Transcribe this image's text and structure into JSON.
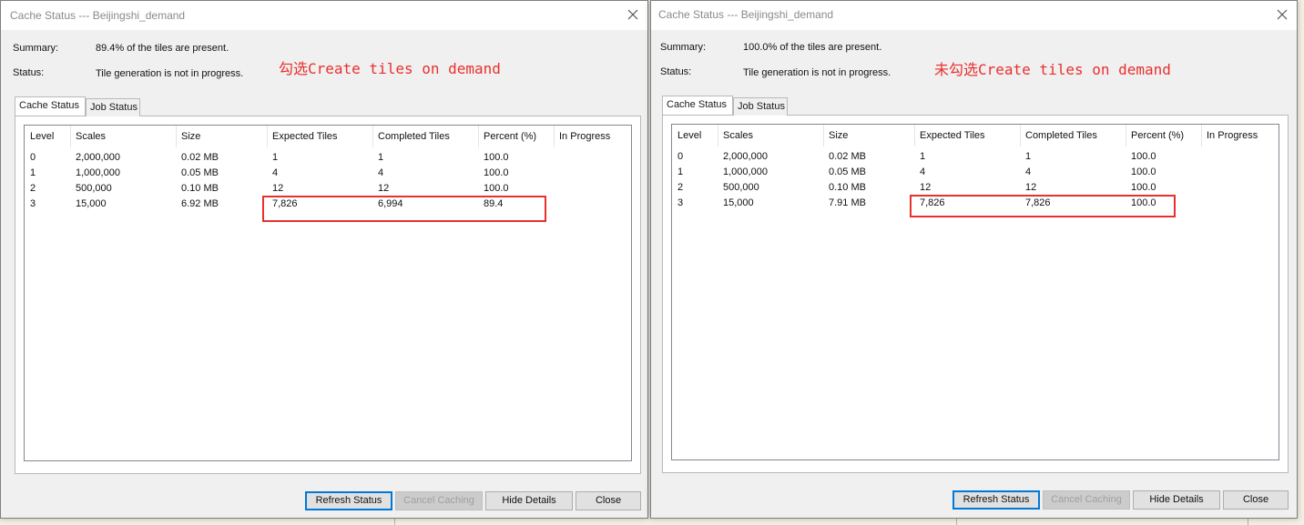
{
  "dialogs": [
    {
      "title": "Cache Status --- Beijingshi_demand",
      "summary_label": "Summary:",
      "summary_value": "89.4% of the tiles are present.",
      "status_label": "Status:",
      "status_value": "Tile generation is not in progress.",
      "annotation": "勾选Create tiles on demand",
      "tabs": [
        "Cache Status",
        "Job Status"
      ],
      "columns": [
        "Level",
        "Scales",
        "Size",
        "Expected Tiles",
        "Completed Tiles",
        "Percent (%)",
        "In Progress"
      ],
      "rows": [
        [
          "0",
          "2,000,000",
          "0.02 MB",
          "1",
          "1",
          "100.0",
          ""
        ],
        [
          "1",
          "1,000,000",
          "0.05 MB",
          "4",
          "4",
          "100.0",
          ""
        ],
        [
          "2",
          "500,000",
          "0.10 MB",
          "12",
          "12",
          "100.0",
          ""
        ],
        [
          "3",
          "15,000",
          "6.92 MB",
          "7,826",
          "6,994",
          "89.4",
          ""
        ]
      ],
      "buttons": [
        "Refresh Status",
        "Cancel Caching",
        "Hide Details",
        "Close"
      ]
    },
    {
      "title": "Cache Status --- Beijingshi_demand",
      "summary_label": "Summary:",
      "summary_value": "100.0% of the tiles are present.",
      "status_label": "Status:",
      "status_value": "Tile generation is not in progress.",
      "annotation": "未勾选Create tiles on demand",
      "tabs": [
        "Cache Status",
        "Job Status"
      ],
      "columns": [
        "Level",
        "Scales",
        "Size",
        "Expected Tiles",
        "Completed Tiles",
        "Percent (%)",
        "In Progress"
      ],
      "rows": [
        [
          "0",
          "2,000,000",
          "0.02 MB",
          "1",
          "1",
          "100.0",
          ""
        ],
        [
          "1",
          "1,000,000",
          "0.05 MB",
          "4",
          "4",
          "100.0",
          ""
        ],
        [
          "2",
          "500,000",
          "0.10 MB",
          "12",
          "12",
          "100.0",
          ""
        ],
        [
          "3",
          "15,000",
          "7.91 MB",
          "7,826",
          "7,826",
          "100.0",
          ""
        ]
      ],
      "buttons": [
        "Refresh Status",
        "Cancel Caching",
        "Hide Details",
        "Close"
      ]
    }
  ],
  "colors": {
    "annotation": "#e8302e",
    "highlight_box": "#e8302e",
    "default_button_border": "#0078d7"
  }
}
